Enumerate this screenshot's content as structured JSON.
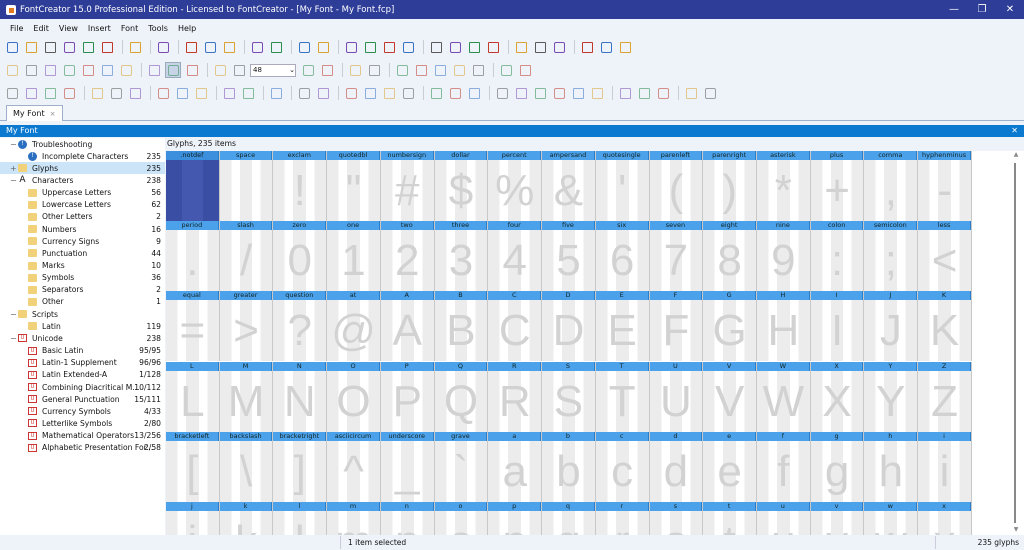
{
  "window": {
    "title": "FontCreator 15.0 Professional Edition - Licensed to FontCreator - [My Font - My Font.fcp]",
    "minimize": "—",
    "restore": "❐",
    "close": "✕"
  },
  "menu": [
    "File",
    "Edit",
    "View",
    "Insert",
    "Font",
    "Tools",
    "Help"
  ],
  "toolbars": [
    [
      "new-project-icon",
      "open-icon",
      "open-font-icon",
      "save-icon",
      "save-all-icon",
      "save-as-icon",
      "|",
      "print-icon",
      "|",
      "find-icon",
      "|",
      "cut-icon",
      "copy-icon",
      "paste-icon",
      "|",
      "undo-icon",
      "redo-icon",
      "|",
      "insert-character-icon",
      "insert-glyph-icon",
      "|",
      "link-icon",
      "unlink-icon",
      "formula-icon",
      "eraser-icon",
      "|",
      "properties-icon",
      "calendar-icon",
      "test-icon",
      "validate-icon",
      "|",
      "preview-icon",
      "report-icon",
      "screen-icon",
      "|",
      "page-icon",
      "page-settings-icon",
      "page-export-icon"
    ],
    [
      "select-rect-icon",
      "lasso-icon",
      "hand-icon",
      "text-icon",
      "measure-icon",
      "pen-icon",
      "fill-icon",
      "|",
      "image-view-icon",
      "contour-view-icon",
      "font-view-icon",
      "|",
      "zoom-in-icon",
      "zoom-out-icon",
      "ZOOM",
      "zoom-fit-icon",
      "zoom-selection-icon",
      "|",
      "flag-icon",
      "flag-split-icon",
      "|",
      "background-image-icon",
      "knife-icon",
      "pencil-icon",
      "rectangle-icon",
      "ellipse-icon",
      "|",
      "back-icon",
      "forward-icon"
    ],
    [
      "align-1-icon",
      "align-2-icon",
      "align-3-icon",
      "align-4-icon",
      "|",
      "distribute-1-icon",
      "distribute-2-icon",
      "distribute-3-icon",
      "|",
      "center-1-icon",
      "center-2-icon",
      "center-3-icon",
      "|",
      "space-1-icon",
      "space-2-icon",
      "|",
      "glyph-ref-icon",
      "|",
      "rotate-icon",
      "hook-icon",
      "|",
      "triangle-1-icon",
      "triangle-2-icon",
      "triangle-3-icon",
      "triangle-4-icon",
      "|",
      "union-icon",
      "intersect-icon",
      "subtract-icon",
      "|",
      "grid-1-icon",
      "grid-2-icon",
      "grid-3-icon",
      "grid-4-icon",
      "grid-5-icon",
      "grid-6-icon",
      "|",
      "anchor-icon",
      "touch-icon",
      "transform-icon",
      "|",
      "nodes-icon",
      "tidy-icon"
    ]
  ],
  "zoom": {
    "value": "48"
  },
  "tab": {
    "label": "My Font",
    "close": "×"
  },
  "panel": {
    "title": "My Font",
    "close": "✕"
  },
  "tree": [
    {
      "label": "Troubleshooting",
      "count": "",
      "icon": "info",
      "level": 0
    },
    {
      "label": "Incomplete Characters",
      "count": "235",
      "icon": "info",
      "level": 1
    },
    {
      "label": "Glyphs",
      "count": "235",
      "icon": "folder",
      "level": 0,
      "selected": true,
      "expander": "+"
    },
    {
      "label": "Characters",
      "count": "238",
      "icon": "A",
      "level": 0
    },
    {
      "label": "Uppercase Letters",
      "count": "56",
      "icon": "folder",
      "level": 1
    },
    {
      "label": "Lowercase Letters",
      "count": "62",
      "icon": "folder",
      "level": 1
    },
    {
      "label": "Other Letters",
      "count": "2",
      "icon": "folder",
      "level": 1
    },
    {
      "label": "Numbers",
      "count": "16",
      "icon": "folder",
      "level": 1
    },
    {
      "label": "Currency Signs",
      "count": "9",
      "icon": "folder",
      "level": 1
    },
    {
      "label": "Punctuation",
      "count": "44",
      "icon": "folder",
      "level": 1
    },
    {
      "label": "Marks",
      "count": "10",
      "icon": "folder",
      "level": 1
    },
    {
      "label": "Symbols",
      "count": "36",
      "icon": "folder",
      "level": 1
    },
    {
      "label": "Separators",
      "count": "2",
      "icon": "folder",
      "level": 1
    },
    {
      "label": "Other",
      "count": "1",
      "icon": "folder",
      "level": 1
    },
    {
      "label": "Scripts",
      "count": "",
      "icon": "folder",
      "level": 0
    },
    {
      "label": "Latin",
      "count": "119",
      "icon": "folder",
      "level": 1
    },
    {
      "label": "Unicode",
      "count": "238",
      "icon": "uni",
      "level": 0
    },
    {
      "label": "Basic Latin",
      "count": "95/95",
      "icon": "uni",
      "level": 1
    },
    {
      "label": "Latin-1 Supplement",
      "count": "96/96",
      "icon": "uni",
      "level": 1
    },
    {
      "label": "Latin Extended-A",
      "count": "1/128",
      "icon": "uni",
      "level": 1
    },
    {
      "label": "Combining Diacritical M...",
      "count": "10/112",
      "icon": "uni",
      "level": 1
    },
    {
      "label": "General Punctuation",
      "count": "15/111",
      "icon": "uni",
      "level": 1
    },
    {
      "label": "Currency Symbols",
      "count": "4/33",
      "icon": "uni",
      "level": 1
    },
    {
      "label": "Letterlike Symbols",
      "count": "2/80",
      "icon": "uni",
      "level": 1
    },
    {
      "label": "Mathematical Operators",
      "count": "13/256",
      "icon": "uni",
      "level": 1
    },
    {
      "label": "Alphabetic Presentation For...",
      "count": "2/58",
      "icon": "uni",
      "level": 1
    }
  ],
  "glyph_header": "Glyphs, 235 items",
  "glyphs": [
    {
      "name": ".notdef",
      "char": ""
    },
    {
      "name": "space",
      "char": ""
    },
    {
      "name": "exclam",
      "char": "!"
    },
    {
      "name": "quotedbl",
      "char": "\""
    },
    {
      "name": "numbersign",
      "char": "#"
    },
    {
      "name": "dollar",
      "char": "$"
    },
    {
      "name": "percent",
      "char": "%"
    },
    {
      "name": "ampersand",
      "char": "&"
    },
    {
      "name": "quotesingle",
      "char": "'"
    },
    {
      "name": "parenleft",
      "char": "("
    },
    {
      "name": "parenright",
      "char": ")"
    },
    {
      "name": "asterisk",
      "char": "*"
    },
    {
      "name": "plus",
      "char": "+"
    },
    {
      "name": "comma",
      "char": ","
    },
    {
      "name": "hyphenminus",
      "char": "-"
    },
    {
      "name": "period",
      "char": "."
    },
    {
      "name": "slash",
      "char": "/"
    },
    {
      "name": "zero",
      "char": "0"
    },
    {
      "name": "one",
      "char": "1"
    },
    {
      "name": "two",
      "char": "2"
    },
    {
      "name": "three",
      "char": "3"
    },
    {
      "name": "four",
      "char": "4"
    },
    {
      "name": "five",
      "char": "5"
    },
    {
      "name": "six",
      "char": "6"
    },
    {
      "name": "seven",
      "char": "7"
    },
    {
      "name": "eight",
      "char": "8"
    },
    {
      "name": "nine",
      "char": "9"
    },
    {
      "name": "colon",
      "char": ":"
    },
    {
      "name": "semicolon",
      "char": ";"
    },
    {
      "name": "less",
      "char": "<"
    },
    {
      "name": "equal",
      "char": "="
    },
    {
      "name": "greater",
      "char": ">"
    },
    {
      "name": "question",
      "char": "?"
    },
    {
      "name": "at",
      "char": "@"
    },
    {
      "name": "A",
      "char": "A"
    },
    {
      "name": "B",
      "char": "B"
    },
    {
      "name": "C",
      "char": "C"
    },
    {
      "name": "D",
      "char": "D"
    },
    {
      "name": "E",
      "char": "E"
    },
    {
      "name": "F",
      "char": "F"
    },
    {
      "name": "G",
      "char": "G"
    },
    {
      "name": "H",
      "char": "H"
    },
    {
      "name": "I",
      "char": "I"
    },
    {
      "name": "J",
      "char": "J"
    },
    {
      "name": "K",
      "char": "K"
    },
    {
      "name": "L",
      "char": "L"
    },
    {
      "name": "M",
      "char": "M"
    },
    {
      "name": "N",
      "char": "N"
    },
    {
      "name": "O",
      "char": "O"
    },
    {
      "name": "P",
      "char": "P"
    },
    {
      "name": "Q",
      "char": "Q"
    },
    {
      "name": "R",
      "char": "R"
    },
    {
      "name": "S",
      "char": "S"
    },
    {
      "name": "T",
      "char": "T"
    },
    {
      "name": "U",
      "char": "U"
    },
    {
      "name": "V",
      "char": "V"
    },
    {
      "name": "W",
      "char": "W"
    },
    {
      "name": "X",
      "char": "X"
    },
    {
      "name": "Y",
      "char": "Y"
    },
    {
      "name": "Z",
      "char": "Z"
    },
    {
      "name": "bracketleft",
      "char": "["
    },
    {
      "name": "backslash",
      "char": "\\"
    },
    {
      "name": "bracketright",
      "char": "]"
    },
    {
      "name": "asciicircum",
      "char": "^"
    },
    {
      "name": "underscore",
      "char": "_"
    },
    {
      "name": "grave",
      "char": "`"
    },
    {
      "name": "a",
      "char": "a"
    },
    {
      "name": "b",
      "char": "b"
    },
    {
      "name": "c",
      "char": "c"
    },
    {
      "name": "d",
      "char": "d"
    },
    {
      "name": "e",
      "char": "e"
    },
    {
      "name": "f",
      "char": "f"
    },
    {
      "name": "g",
      "char": "g"
    },
    {
      "name": "h",
      "char": "h"
    },
    {
      "name": "i",
      "char": "i"
    },
    {
      "name": "j",
      "char": "j"
    },
    {
      "name": "k",
      "char": "k"
    },
    {
      "name": "l",
      "char": "l"
    },
    {
      "name": "m",
      "char": "m"
    },
    {
      "name": "n",
      "char": "n"
    },
    {
      "name": "o",
      "char": "o"
    },
    {
      "name": "p",
      "char": "p"
    },
    {
      "name": "q",
      "char": "q"
    },
    {
      "name": "r",
      "char": "r"
    },
    {
      "name": "s",
      "char": "s"
    },
    {
      "name": "t",
      "char": "t"
    },
    {
      "name": "u",
      "char": "u"
    },
    {
      "name": "v",
      "char": "v"
    },
    {
      "name": "w",
      "char": "w"
    },
    {
      "name": "x",
      "char": "x"
    }
  ],
  "selected_glyph": ".notdef",
  "status": {
    "selection": "1 item selected",
    "count": "235 glyphs"
  }
}
